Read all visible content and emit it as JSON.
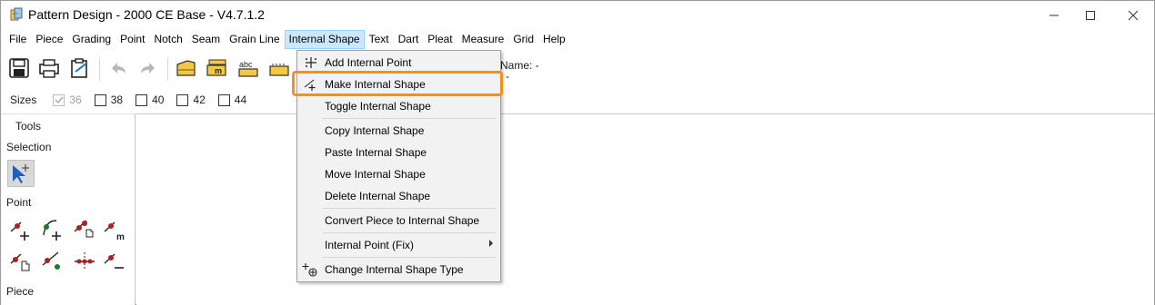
{
  "window": {
    "title": "Pattern Design - 2000 CE Base - V4.7.1.2"
  },
  "menubar": {
    "items": [
      "File",
      "Piece",
      "Grading",
      "Point",
      "Notch",
      "Seam",
      "Grain Line",
      "Internal Shape",
      "Text",
      "Dart",
      "Pleat",
      "Measure",
      "Grid",
      "Help"
    ],
    "active": "Internal Shape"
  },
  "toolbar": {
    "buttons": [
      "save-icon",
      "print-icon",
      "properties-icon",
      "undo-icon",
      "redo-icon",
      "piece-icon",
      "measure-piece-icon",
      "text-abc-icon",
      "seam-icon"
    ],
    "piece_name_label": "Name: -",
    "piece_name_label2": "-"
  },
  "sizes": {
    "label": "Sizes",
    "items": [
      {
        "label": "36",
        "checked": true,
        "disabled": true
      },
      {
        "label": "38",
        "checked": false,
        "disabled": false
      },
      {
        "label": "40",
        "checked": false,
        "disabled": false
      },
      {
        "label": "42",
        "checked": false,
        "disabled": false
      },
      {
        "label": "44",
        "checked": false,
        "disabled": false
      }
    ]
  },
  "tools": {
    "title": "Tools",
    "selection_label": "Selection",
    "point_label": "Point",
    "piece_label": "Piece"
  },
  "dropdown": {
    "items": [
      {
        "label": "Add Internal Point",
        "icon": "add-internal-point-icon"
      },
      {
        "label": "Make Internal Shape",
        "icon": "make-internal-shape-icon",
        "highlighted": true
      },
      {
        "label": "Toggle Internal Shape",
        "icon": ""
      },
      {
        "label": "Copy Internal Shape",
        "icon": ""
      },
      {
        "label": "Paste Internal Shape",
        "icon": ""
      },
      {
        "label": "Move Internal Shape",
        "icon": ""
      },
      {
        "label": "Delete Internal Shape",
        "icon": ""
      },
      {
        "label": "Convert Piece to Internal Shape",
        "icon": ""
      },
      {
        "label": "Internal Point (Fix)",
        "icon": "",
        "submenu": true
      },
      {
        "label": "Change Internal Shape Type",
        "icon": "change-shape-type-icon"
      }
    ]
  },
  "colors": {
    "highlight": "#f0931e",
    "menu_active": "#cce8ff",
    "point_red": "#b02020",
    "point_green": "#1a7a2a",
    "icon_yellow": "#f5c842"
  }
}
